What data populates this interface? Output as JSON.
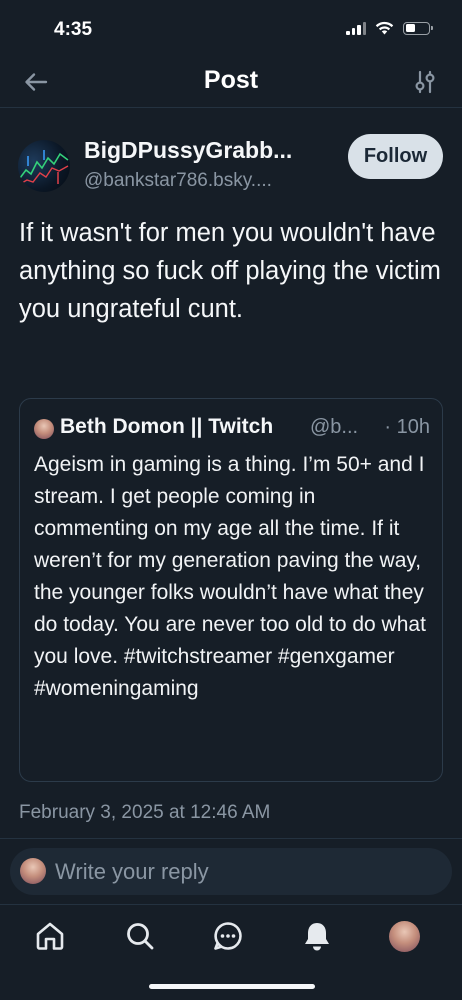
{
  "status_bar": {
    "time": "4:35"
  },
  "nav": {
    "title": "Post"
  },
  "post": {
    "author_name": "BigDPussyGrabb...",
    "author_handle": "@bankstar786.bsky....",
    "follow_label": "Follow",
    "text": "If it wasn't for men you wouldn't have anything so fuck off playing the victim you ungrateful cunt.",
    "date": "February 3, 2025 at 12:46 AM"
  },
  "quote": {
    "author_name": "Beth Domon || Twitch",
    "author_handle": "@b...",
    "time": "· 10h",
    "text": "Ageism in gaming is a thing.  I’m 50+ and I stream.  I get people coming in commenting on my age all the time. If it weren’t for my generation paving the way, the younger folks wouldn’t have what they do today. You are never too old to do what you love. #twitchstreamer #genxgamer #womeningaming"
  },
  "reply": {
    "placeholder": "Write your reply"
  },
  "tabs": [
    "home-icon",
    "search-icon",
    "chat-icon",
    "bell-icon",
    "profile-avatar"
  ],
  "colors": {
    "background": "#161e27",
    "follow_button": "#d9e1e8",
    "secondary_text": "#8a96a3"
  }
}
